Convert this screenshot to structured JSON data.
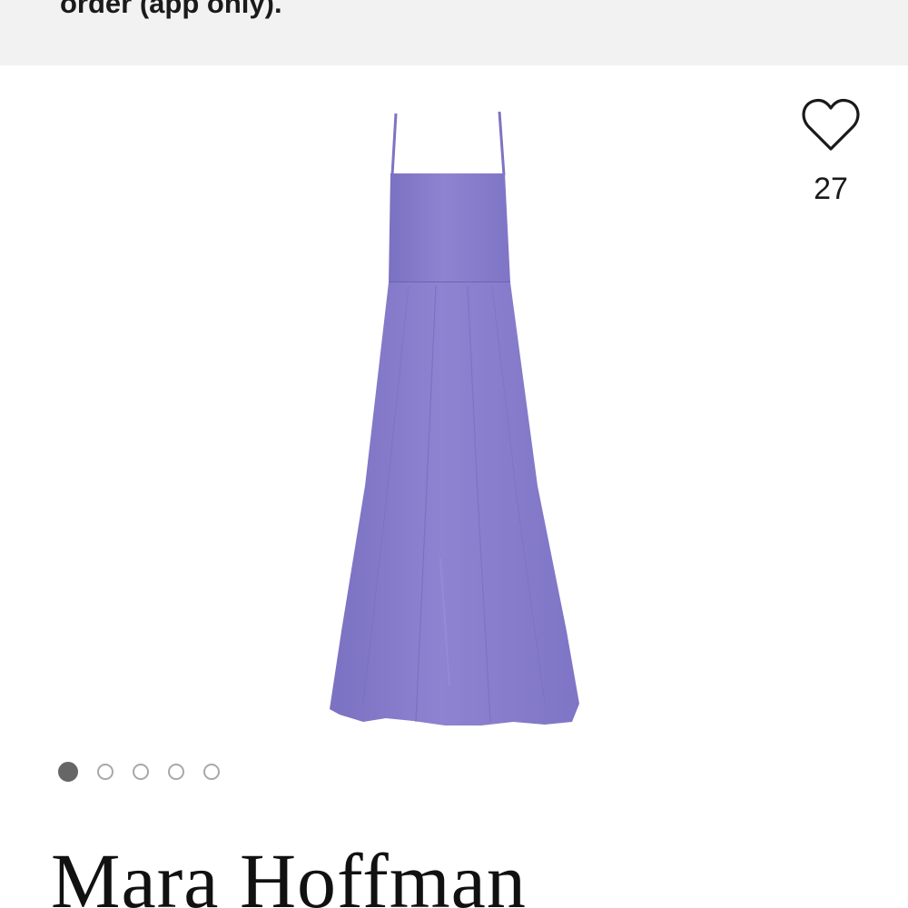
{
  "promo_banner": {
    "text": "order (app only)."
  },
  "product": {
    "image_icon": "purple-midi-dress-image",
    "dress_color": "#8a80cc",
    "favorite": {
      "icon": "heart-outline-icon",
      "count": "27"
    },
    "carousel": {
      "total": 5,
      "active_index": 0
    },
    "brand": "Mara Hoffman"
  }
}
